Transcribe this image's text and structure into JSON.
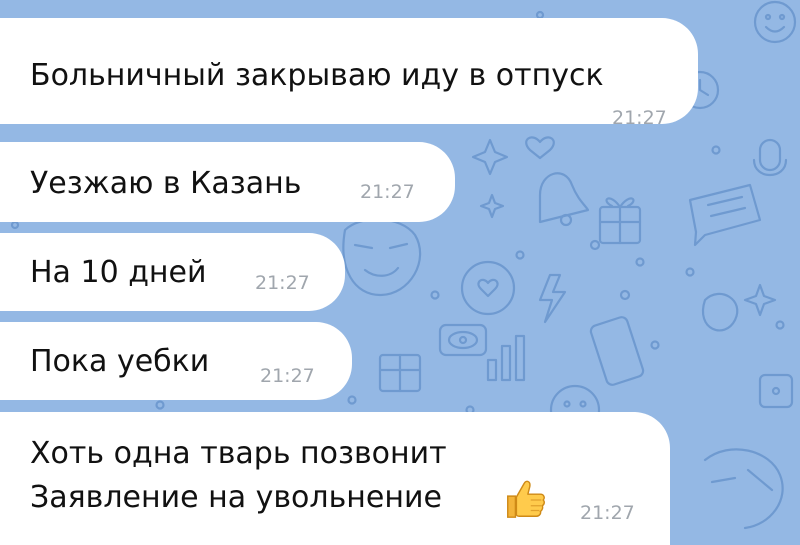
{
  "theme": {
    "wallpaper_color": "#94b8e4",
    "bubble_color": "#ffffff",
    "doodle_color": "#6f9ad0",
    "time_color": "#a0a6ad"
  },
  "messages": [
    {
      "text": "Больничный закрываю иду в отпуск",
      "time": "21:27"
    },
    {
      "text": "Уезжаю в Казань",
      "time": "21:27"
    },
    {
      "text": "На 10 дней",
      "time": "21:27"
    },
    {
      "text": "Пока уебки",
      "time": "21:27"
    },
    {
      "lines": [
        "Хоть одна тварь позвонит",
        "Заявление на увольнение"
      ],
      "emoji": "thumbs-up-icon",
      "time": "21:27"
    }
  ]
}
